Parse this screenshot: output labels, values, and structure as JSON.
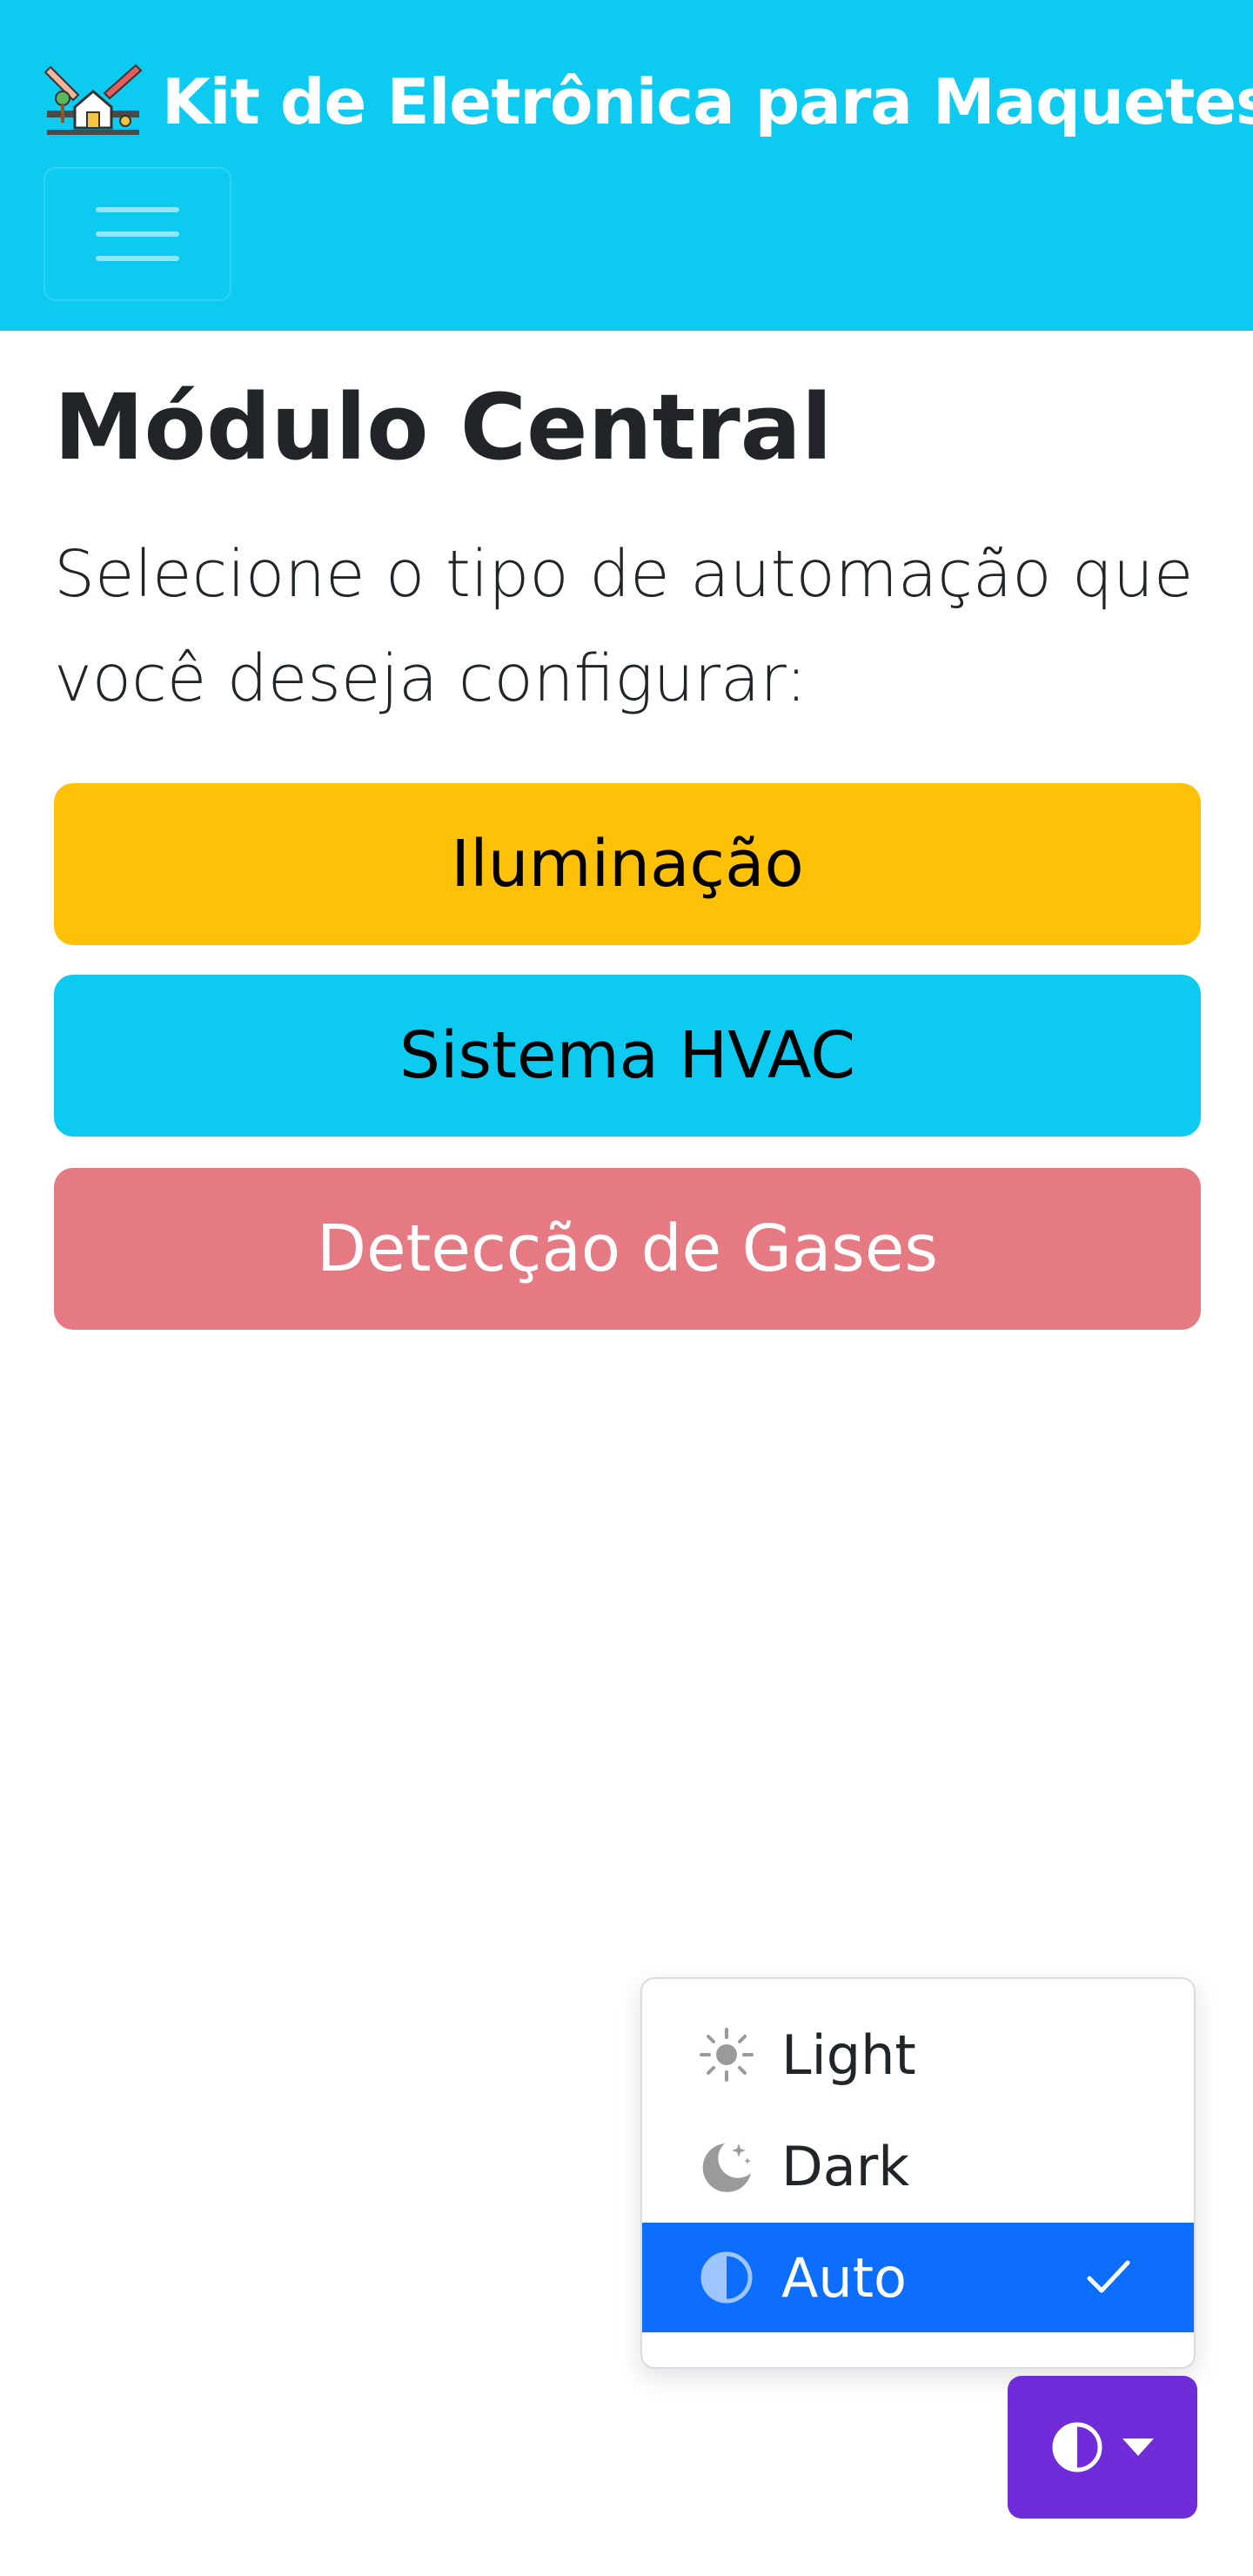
{
  "navbar": {
    "brand_title": "Kit de Eletrônica para Maquetes",
    "logo_icon": "tools-house-logo-icon",
    "toggler_icon": "hamburger-menu-icon",
    "background_color": "#0dcaf0"
  },
  "main": {
    "title": "Módulo Central",
    "lead": "Selecione o tipo de automação que você deseja configurar:",
    "buttons": [
      {
        "label": "Iluminação",
        "color": "#ffc107"
      },
      {
        "label": "Sistema HVAC",
        "color": "#0dcaf0"
      },
      {
        "label": "Detecção de Gases",
        "color": "#e67a83"
      }
    ]
  },
  "theme_menu": {
    "items": [
      {
        "label": "Light",
        "icon": "sun-icon"
      },
      {
        "label": "Dark",
        "icon": "moon-stars-icon"
      },
      {
        "label": "Auto",
        "icon": "circle-half-icon",
        "active": true
      }
    ],
    "active_color": "#0d6efd",
    "check_icon": "check-icon",
    "toggle_icon": "circle-half-icon",
    "toggle_color": "#6f2cd8"
  }
}
